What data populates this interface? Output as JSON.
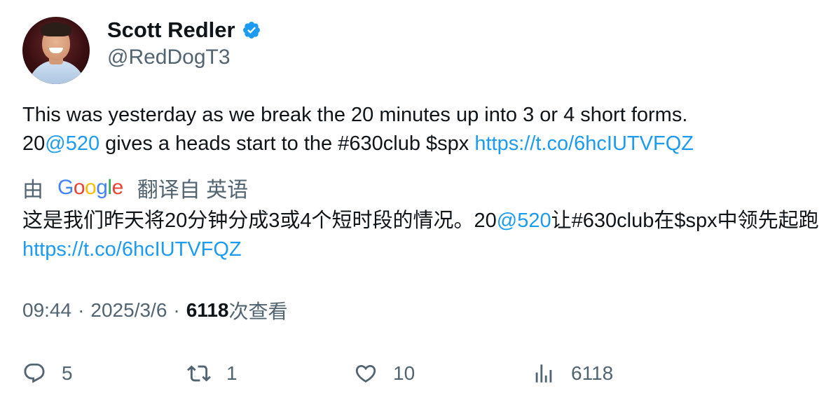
{
  "author": {
    "name": "Scott Redler",
    "handle": "@RedDogT3",
    "verified": true
  },
  "tweet": {
    "line1": "This was yesterday as we break the 20 minutes up into 3 or 4 short forms.",
    "line2_prefix": "20",
    "mention": "@520",
    "line2_mid": " gives a heads start to the #630club $spx ",
    "link": "https://t.co/6hcIUTVFQZ"
  },
  "translation": {
    "by_label": "由",
    "google_logo": "Google",
    "source_label": "翻译自 英语",
    "part1": "这是我们昨天将20分钟分成3或4个短时段的情况。20",
    "mention": "@520",
    "part2": "让#630club在$spx中领先起跑 ",
    "link": "https://t.co/6hcIUTVFQZ"
  },
  "meta": {
    "time": "09:44",
    "date": "2025/3/6",
    "separator": "·",
    "views": "6118",
    "views_label": "次查看"
  },
  "actions": {
    "reply_count": "5",
    "retweet_count": "1",
    "like_count": "10",
    "views_count": "6118"
  },
  "colors": {
    "link": "#1d9bf0",
    "secondary_text": "#536471",
    "primary_text": "#0f1419",
    "verified_badge": "#1d9bf0"
  },
  "icons": [
    "verified-badge-icon",
    "reply-icon",
    "retweet-icon",
    "like-icon",
    "views-icon"
  ]
}
